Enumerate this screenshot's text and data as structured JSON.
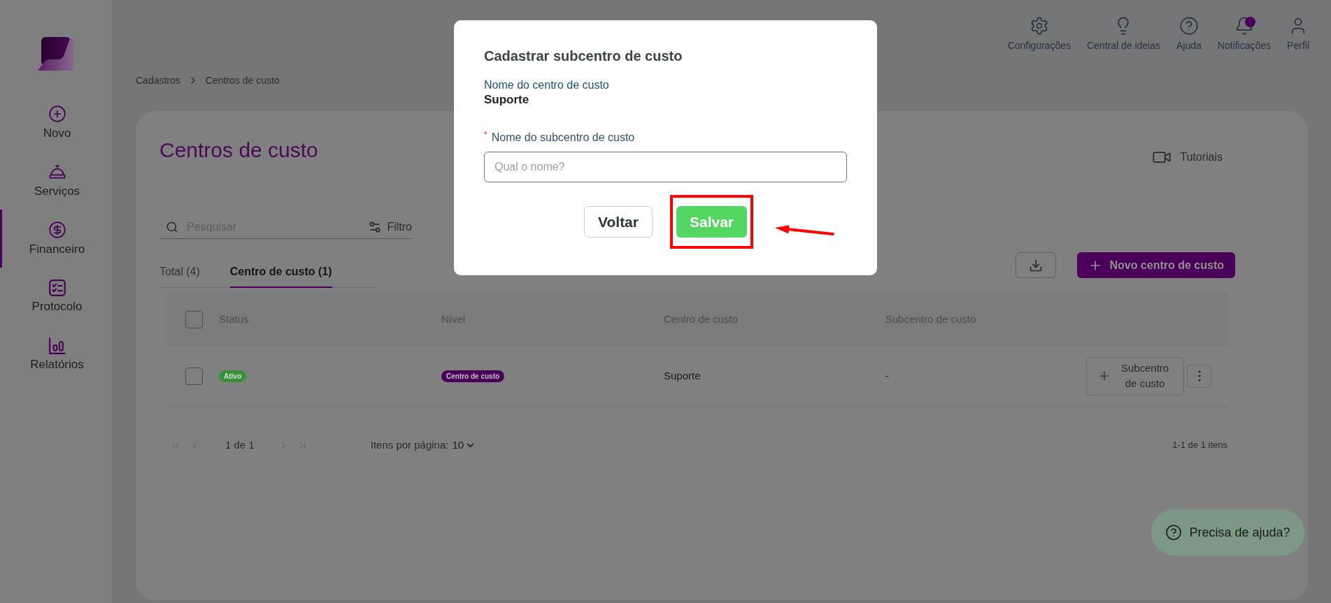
{
  "sidebar": {
    "items": [
      {
        "label": "Novo",
        "selected": false
      },
      {
        "label": "Serviços",
        "selected": false
      },
      {
        "label": "Financeiro",
        "selected": true
      },
      {
        "label": "Protocolo",
        "selected": false
      },
      {
        "label": "Relatórios",
        "selected": false
      }
    ]
  },
  "header": {
    "actions": [
      {
        "label": "Configurações",
        "notification": false
      },
      {
        "label": "Central de ideias",
        "notification": false
      },
      {
        "label": "Ajuda",
        "notification": false
      },
      {
        "label": "Notificações",
        "notification": true
      },
      {
        "label": "Perfil",
        "notification": false
      }
    ]
  },
  "breadcrumb": [
    "Cadastros",
    "Centros de custo"
  ],
  "page": {
    "title": "Centros de custo",
    "tutorials": "Tutoriais",
    "search_placeholder": "Pesquisar",
    "filter": "Filtro",
    "tabs": [
      {
        "label": "Total (4)",
        "selected": false
      },
      {
        "label": "Centro de custo (1)",
        "selected": true
      }
    ],
    "new_button": "Novo centro de custo"
  },
  "table": {
    "select_all_checked": false,
    "columns": [
      "Status",
      "Nível",
      "Centro de custo",
      "Subcentro de custo"
    ],
    "rows": [
      {
        "checked": false,
        "status": "Ativo",
        "nivel": "Centro de custo",
        "cost_center": "Suporte",
        "subcenter": "-",
        "action": "Subcentro de custo"
      }
    ]
  },
  "pagination": {
    "nav_disabled": true,
    "page": "1 de 1",
    "per_page_label": "Itens por página:",
    "per_page": "10",
    "range": "1-1 de 1 itens"
  },
  "help_button": "Precisa de ajuda?",
  "modal": {
    "title": "Cadastrar subcentro de custo",
    "info_label": "Nome do centro de custo",
    "info_value": "Suporte",
    "field": {
      "required_mark": "*",
      "label": "Nome do subcentro de custo",
      "placeholder": "Qual o nome?"
    },
    "buttons": [
      {
        "label": "Voltar",
        "kind": "secondary",
        "highlighted": false
      },
      {
        "label": "Salvar",
        "kind": "primary",
        "highlighted": true
      }
    ]
  }
}
